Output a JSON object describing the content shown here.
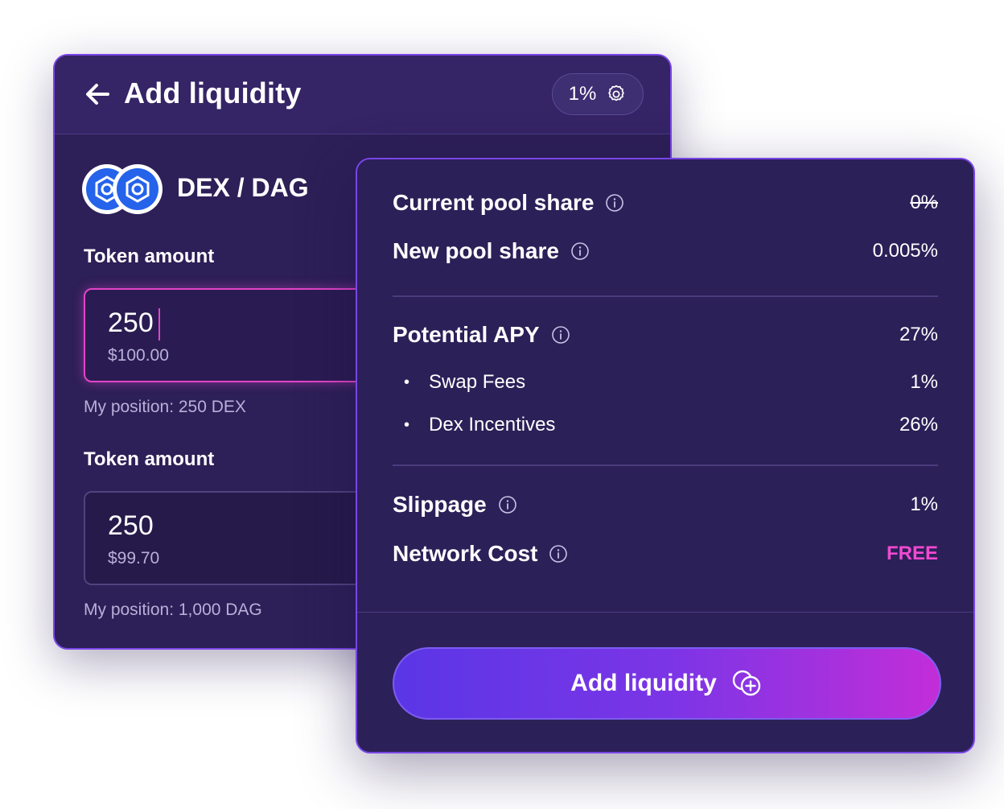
{
  "back_card": {
    "title": "Add liquidity",
    "slippage_pill": "1%",
    "pair": "DEX / DAG",
    "token_a": {
      "label": "Token amount",
      "value": "250",
      "usd": "$100.00",
      "position": "My position: 250 DEX"
    },
    "token_b": {
      "label": "Token amount",
      "value": "250",
      "usd": "$99.70",
      "position": "My position: 1,000 DAG"
    }
  },
  "details": {
    "current_pool_share": {
      "label": "Current pool share",
      "value": "0%"
    },
    "new_pool_share": {
      "label": "New pool share",
      "value": "0.005%"
    },
    "potential_apy": {
      "label": "Potential APY",
      "value": "27%"
    },
    "swap_fees": {
      "label": "Swap Fees",
      "value": "1%"
    },
    "dex_incentives": {
      "label": "Dex Incentives",
      "value": "26%"
    },
    "slippage": {
      "label": "Slippage",
      "value": "1%"
    },
    "network_cost": {
      "label": "Network Cost",
      "value": "FREE"
    }
  },
  "cta_label": "Add liquidity",
  "colors": {
    "card_bg": "#2c2058",
    "border_accent": "#7a45e8",
    "free_pink": "#f04ad0",
    "button_start": "#5a36e6",
    "button_end": "#c22ed8",
    "coin_blue": "#2563eb"
  },
  "icons": [
    "arrow-left-icon",
    "gear-icon",
    "info-icon",
    "add-circle-icon"
  ]
}
